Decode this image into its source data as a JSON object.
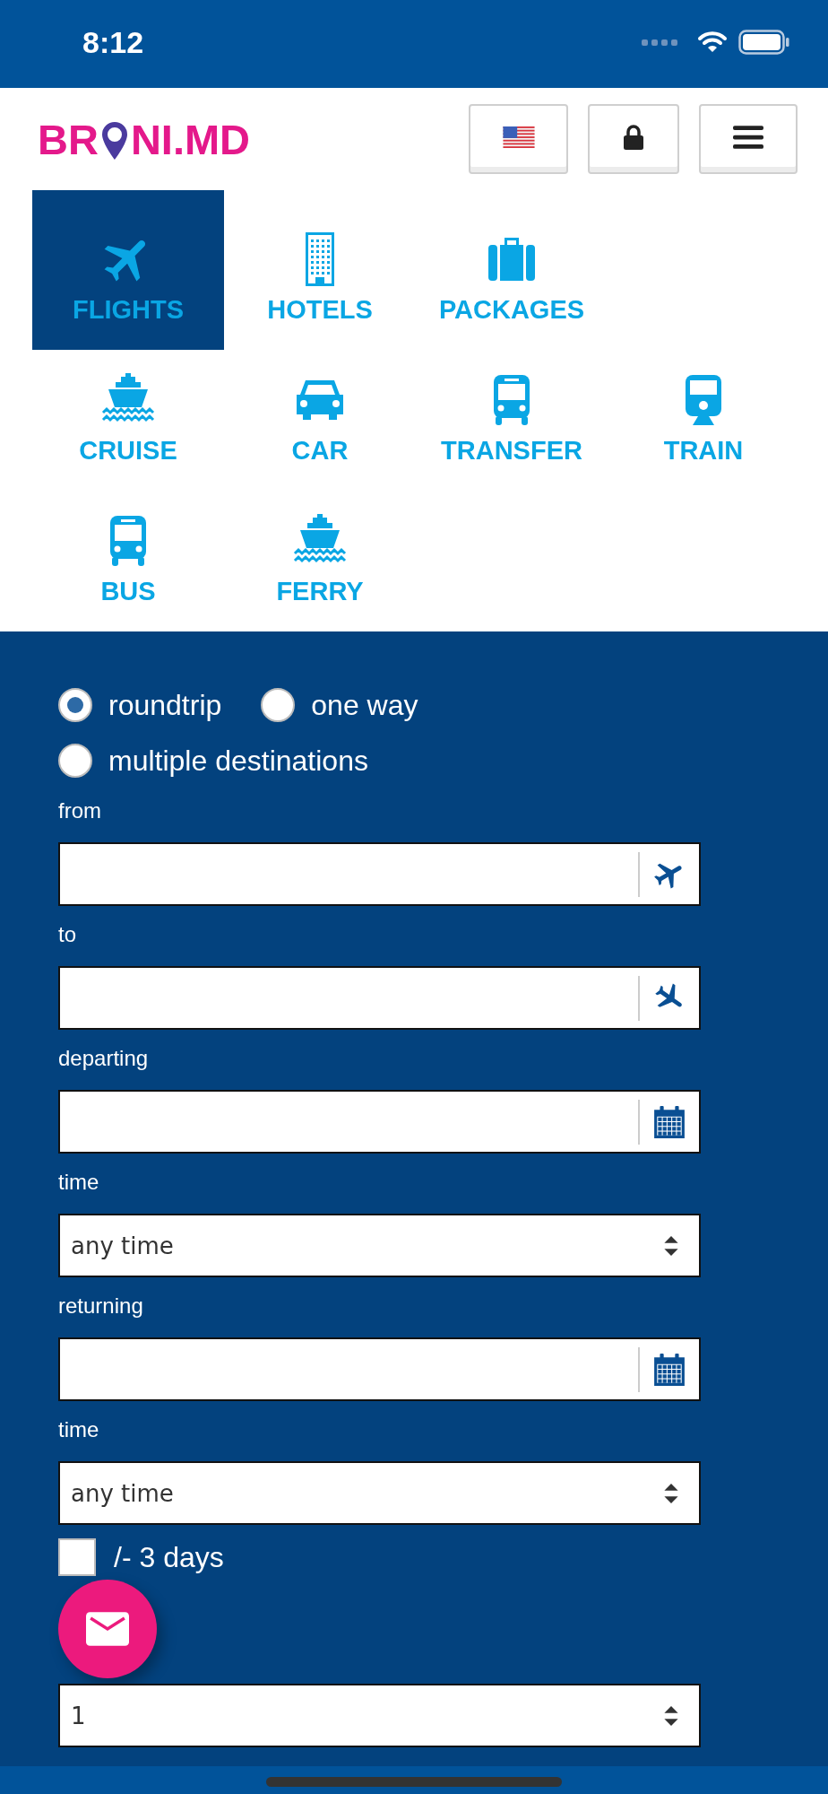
{
  "status_bar": {
    "time": "8:12"
  },
  "header": {
    "logo_left": "BR",
    "logo_right": "NI.MD",
    "buttons": [
      {
        "kind": "flag"
      },
      {
        "kind": "lock"
      },
      {
        "kind": "menu"
      }
    ]
  },
  "nav_rows": [
    [
      {
        "label": "FLIGHTS",
        "kind": "plane",
        "selected": true
      },
      {
        "label": "HOTELS",
        "kind": "building",
        "selected": false
      },
      {
        "label": "PACKAGES",
        "kind": "suitcase",
        "selected": false
      }
    ],
    [
      {
        "label": "CRUISE",
        "kind": "ship",
        "selected": false
      },
      {
        "label": "CAR",
        "kind": "car",
        "selected": false
      },
      {
        "label": "TRANSFER",
        "kind": "bus",
        "selected": false
      },
      {
        "label": "TRAIN",
        "kind": "train",
        "selected": false
      }
    ],
    [
      {
        "label": "BUS",
        "kind": "bus",
        "selected": false
      },
      {
        "label": "FERRY",
        "kind": "ship",
        "selected": false
      }
    ]
  ],
  "trip_types": [
    {
      "label": "roundtrip",
      "selected": true
    },
    {
      "label": "one way",
      "selected": false
    },
    {
      "label": "multiple destinations",
      "selected": false
    }
  ],
  "fields": [
    {
      "label": "from",
      "kind": "depart"
    },
    {
      "label": "to",
      "kind": "arrive"
    },
    {
      "label": "departing",
      "kind": "date"
    },
    {
      "label": "time",
      "kind": "select",
      "value": "any time"
    },
    {
      "label": "returning",
      "kind": "date"
    },
    {
      "label": "time",
      "kind": "select",
      "value": "any time"
    }
  ],
  "flex_days": {
    "label": "/- 3 days",
    "checked": false
  },
  "travelers": {
    "value": "1"
  }
}
